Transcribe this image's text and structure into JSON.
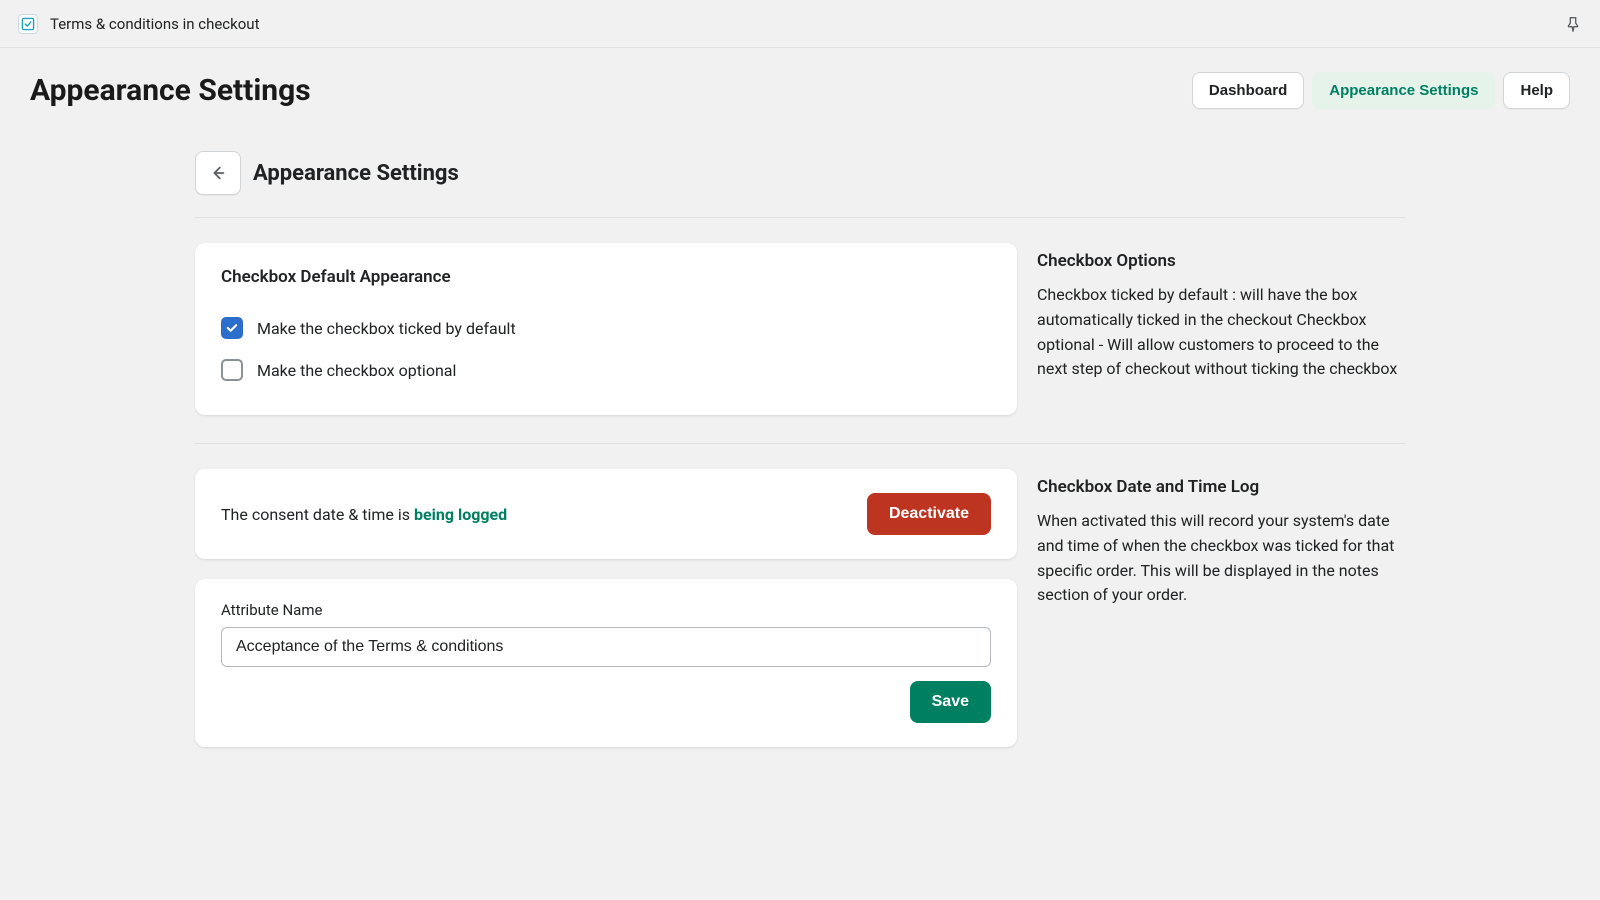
{
  "topbar": {
    "app_title": "Terms & conditions in checkout"
  },
  "header": {
    "page_title": "Appearance Settings",
    "nav": {
      "dashboard": "Dashboard",
      "appearance": "Appearance Settings",
      "help": "Help"
    }
  },
  "section": {
    "title": "Appearance Settings"
  },
  "checkbox_card": {
    "title": "Checkbox Default Appearance",
    "opt1_label": "Make the checkbox ticked by default",
    "opt1_checked": true,
    "opt2_label": "Make the checkbox optional",
    "opt2_checked": false
  },
  "side1": {
    "title": "Checkbox Options",
    "text": "Checkbox ticked by default : will have the box automatically ticked in the checkout Checkbox optional - Will allow customers to proceed to the next step of checkout without ticking the checkbox"
  },
  "consent": {
    "text_prefix": "The consent date & time is ",
    "status": "being logged",
    "deactivate": "Deactivate"
  },
  "attribute": {
    "label": "Attribute Name",
    "value": "Acceptance of the Terms & conditions",
    "save": "Save"
  },
  "side2": {
    "title": "Checkbox Date and Time Log",
    "text": "When activated this will record your system's date and time of when the checkbox was ticked for that specific order. This will be displayed in the notes section of your order."
  }
}
